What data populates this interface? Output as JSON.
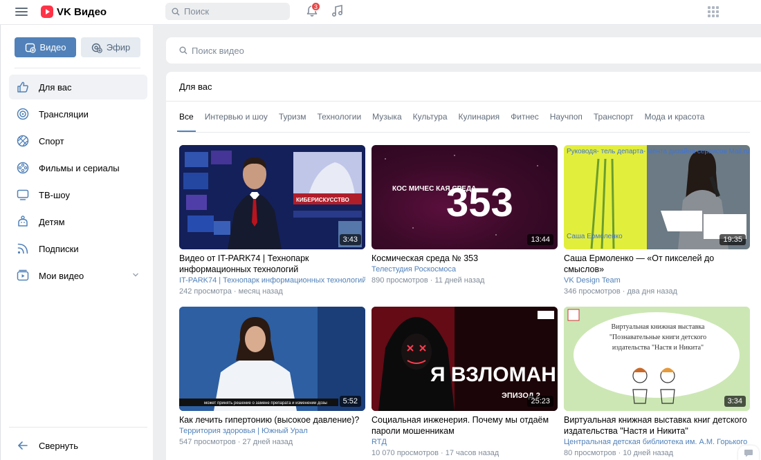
{
  "header": {
    "app_name": "VK Видео",
    "search_placeholder": "Поиск",
    "notifications_count": "3"
  },
  "sidebar": {
    "video_button": "Видео",
    "efir_button": "Эфир",
    "items": [
      {
        "label": "Для вас",
        "icon": "thumbs-up-icon"
      },
      {
        "label": "Трансляции",
        "icon": "broadcast-icon"
      },
      {
        "label": "Спорт",
        "icon": "ball-icon"
      },
      {
        "label": "Фильмы и сериалы",
        "icon": "film-reel-icon"
      },
      {
        "label": "ТВ-шоу",
        "icon": "tv-icon"
      },
      {
        "label": "Детям",
        "icon": "kids-icon"
      },
      {
        "label": "Подписки",
        "icon": "subscriptions-icon"
      },
      {
        "label": "Мои видео",
        "icon": "my-video-icon"
      }
    ],
    "collapse_label": "Свернуть"
  },
  "main": {
    "search_placeholder": "Поиск видео",
    "section_title": "Для вас",
    "tabs": [
      "Все",
      "Интервью и шоу",
      "Туризм",
      "Технологии",
      "Музыка",
      "Культура",
      "Кулинария",
      "Фитнес",
      "Научпоп",
      "Транспорт",
      "Мода и красота"
    ],
    "active_tab": "Все",
    "videos": [
      {
        "title": "Видео от IT-PARK74 | Технопарк информационных технологий",
        "channel": "IT-PARK74 | Технопарк информационных технологий",
        "views": "242 просмотра",
        "age": "месяц назад",
        "duration": "3:43",
        "thumb_text": "КИБЕРИСКУССТВО"
      },
      {
        "title": "Космическая среда № 353",
        "channel": "Телестудия Роскосмоса",
        "views": "890 просмотров",
        "age": "11 дней назад",
        "duration": "13:44",
        "thumb_text": "353",
        "thumb_text2": "КОС МИЧЕС КАЯ СРЕДА"
      },
      {
        "title": "Саша Ермоленко — «От пикселей до смыслов»",
        "channel": "VK Design Team",
        "views": "346 просмотров",
        "age": "два дня назад",
        "duration": "19:35",
        "thumb_text": "Руководя- тель департа- мента дизайна сервисов Mail.ru Group",
        "thumb_text2": "Саша Ермоленко"
      },
      {
        "title": "Как лечить гипертонию (высокое давление)?",
        "channel": "Территория здоровья | Южный Урал",
        "views": "547 просмотров",
        "age": "27 дней назад",
        "duration": "5:52",
        "thumb_text": "может принять решение о замене препарата и изменении дозы"
      },
      {
        "title": "Социальная инженерия. Почему мы отдаём пароли мошенникам",
        "channel": "RTД",
        "views": "10 070 просмотров",
        "age": "17 часов назад",
        "duration": "25:23",
        "thumb_text": "Я ВЗЛОМАН",
        "thumb_text2": "ЭПИЗОД 2"
      },
      {
        "title": "Виртуальная книжная выставка книг детского издательства \"Настя и Никита\"",
        "channel": "Центральная детская библиотека им. А.М. Горького",
        "views": "80 просмотров",
        "age": "10 дней назад",
        "duration": "3:34",
        "thumb_text": "Виртуальная книжная выставка \"Познавательные книги детского издательства \"Настя и Никита\""
      }
    ],
    "meta_separator": "·"
  },
  "colors": {
    "accent": "#5181b8",
    "logo_red": "#ff3347",
    "badge_red": "#e64646"
  }
}
